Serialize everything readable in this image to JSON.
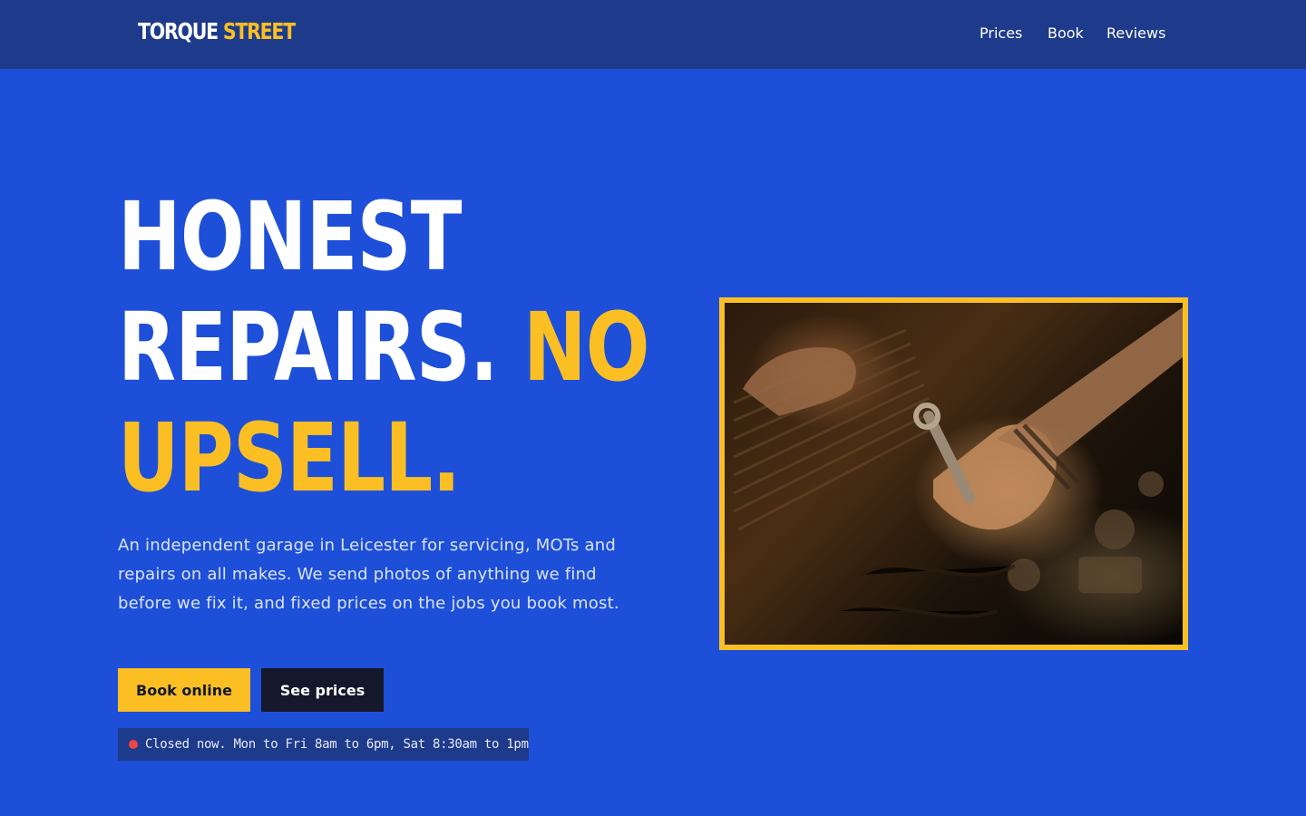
{
  "header": {
    "logo_word1": "TORQUE",
    "logo_word2": "STREET",
    "nav": [
      {
        "label": "Prices"
      },
      {
        "label": "Book"
      },
      {
        "label": "Reviews"
      }
    ]
  },
  "hero": {
    "title_line1": "HONEST",
    "title_line2_main": "REPAIRS.",
    "title_line2_accent": "NO",
    "title_line3_accent": "UPSELL.",
    "intro": "An independent garage in Leicester for servicing, MOTs and repairs on all makes. We send photos of anything we find before we fix it, and fixed prices on the jobs you book most.",
    "primary_button": "Book online",
    "secondary_button": "See prices",
    "status_text": "Closed now. Mon to Fri 8am to 6pm, Sat 8:30am to 1pm"
  },
  "colors": {
    "background": "#1e4fd8",
    "header": "#1e3a8a",
    "accent": "#fbbf24",
    "dark_button": "#15172a",
    "status_closed": "#ef4444"
  }
}
